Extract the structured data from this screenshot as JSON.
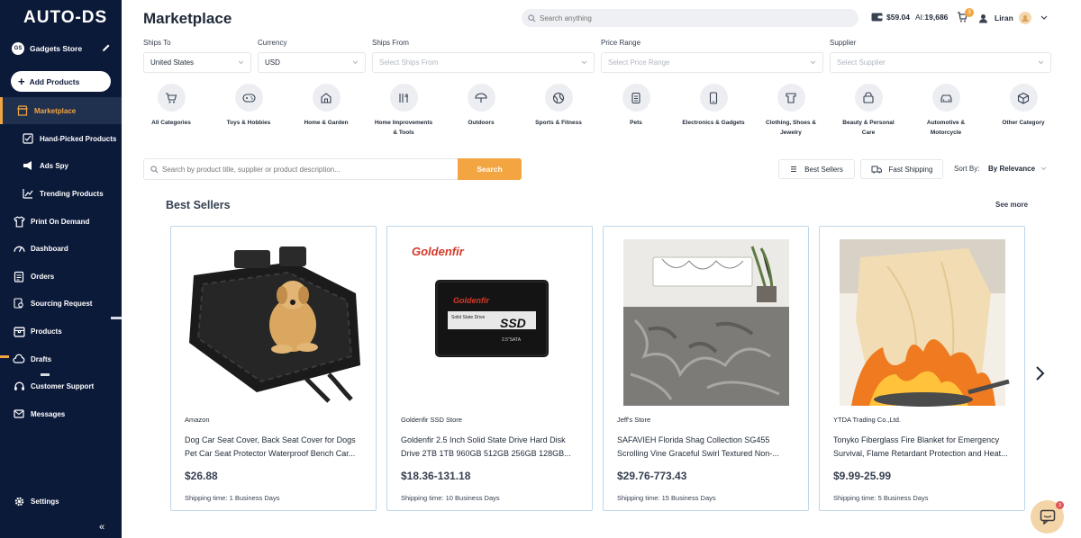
{
  "logo": "AUTO-DS",
  "store": {
    "badge": "GS",
    "name": "Gadgets Store"
  },
  "add_products_label": "Add Products",
  "sidebar": {
    "items": [
      {
        "label": "Marketplace",
        "icon": "store-icon",
        "active": true
      },
      {
        "label": "Hand-Picked Products",
        "icon": "hand-picked-icon"
      },
      {
        "label": "Ads Spy",
        "icon": "megaphone-icon"
      },
      {
        "label": "Trending Products",
        "icon": "trending-chart-icon"
      },
      {
        "label": "Print On Demand",
        "icon": "shirt-icon"
      },
      {
        "label": "Dashboard",
        "icon": "gauge-icon"
      },
      {
        "label": "Orders",
        "icon": "clipboard-icon"
      },
      {
        "label": "Sourcing Request",
        "icon": "magnifier-icon"
      },
      {
        "label": "Products",
        "icon": "box-icon"
      },
      {
        "label": "Drafts",
        "icon": "cloud-icon"
      },
      {
        "label": "Customer Support",
        "icon": "headset-icon"
      },
      {
        "label": "Messages",
        "icon": "envelope-icon"
      }
    ],
    "settings_label": "Settings",
    "collapse_label": "«"
  },
  "header": {
    "title": "Marketplace",
    "search_placeholder": "Search anything",
    "balance": "$59.04",
    "ai_label": "AI:",
    "ai_value": "19,686",
    "notification_count": "3",
    "user_name": "Liran"
  },
  "filters": {
    "ships_to": {
      "label": "Ships To",
      "value": "United States"
    },
    "currency": {
      "label": "Currency",
      "value": "USD"
    },
    "ships_from": {
      "label": "Ships From",
      "placeholder": "Select Ships From"
    },
    "price_range": {
      "label": "Price Range",
      "placeholder": "Select Price Range"
    },
    "supplier": {
      "label": "Supplier",
      "placeholder": "Select Supplier"
    }
  },
  "categories": [
    {
      "label": "All Categories",
      "icon": "cart-icon"
    },
    {
      "label": "Toys & Hobbies",
      "icon": "gamepad-icon"
    },
    {
      "label": "Home & Garden",
      "icon": "home-icon"
    },
    {
      "label": "Home Improvements & Tools",
      "icon": "tools-icon"
    },
    {
      "label": "Outdoors",
      "icon": "umbrella-icon"
    },
    {
      "label": "Sports & Fitness",
      "icon": "ball-icon"
    },
    {
      "label": "Pets",
      "icon": "pet-icon"
    },
    {
      "label": "Electronics & Gadgets",
      "icon": "phone-icon"
    },
    {
      "label": "Clothing, Shoes & Jewelry",
      "icon": "clothing-icon"
    },
    {
      "label": "Beauty & Personal Care",
      "icon": "beauty-icon"
    },
    {
      "label": "Automotive & Motorcycle",
      "icon": "car-icon"
    },
    {
      "label": "Other Category",
      "icon": "cube-icon"
    }
  ],
  "product_search": {
    "placeholder": "Search by product title, supplier or product description...",
    "button": "Search"
  },
  "toolbar": {
    "best_sellers": "Best Sellers",
    "fast_shipping": "Fast Shipping",
    "sort_label": "Sort By:",
    "sort_value": "By Relevance"
  },
  "section": {
    "title": "Best Sellers",
    "see_more": "See more"
  },
  "products": [
    {
      "store": "Amazon",
      "title": "Dog Car Seat Cover, Back Seat Cover for Dogs Pet Car Seat Protector Waterproof Bench Car...",
      "price": "$26.88",
      "shipping": "Shipping time: 1 Business Days"
    },
    {
      "store": "Goldenfir SSD Store",
      "title": "Goldenfir 2.5 Inch Solid State Drive Hard Disk Drive 2TB 1TB 960GB 512GB 256GB 128GB...",
      "price": "$18.36-131.18",
      "shipping": "Shipping time: 10 Business Days",
      "brand": "Goldenfir",
      "drive_label": "Solid State Drive",
      "ssd": "SSD",
      "sata": "2.5\"SATA"
    },
    {
      "store": "Jeff's Store",
      "title": "SAFAVIEH Florida Shag Collection SG455 Scrolling Vine Graceful Swirl Textured Non-...",
      "price": "$29.76-773.43",
      "shipping": "Shipping time: 15 Business Days"
    },
    {
      "store": "YTDA Trading Co.,Ltd.",
      "title": "Tonyko Fiberglass Fire Blanket for Emergency Survival, Flame Retardant Protection and Heat...",
      "price": "$9.99-25.99",
      "shipping": "Shipping time: 5 Business Days"
    }
  ],
  "chat_badge": "3",
  "colors": {
    "sidebar": "#0c1a3a",
    "accent": "#f2a541",
    "card_border": "#bfd7ea"
  }
}
